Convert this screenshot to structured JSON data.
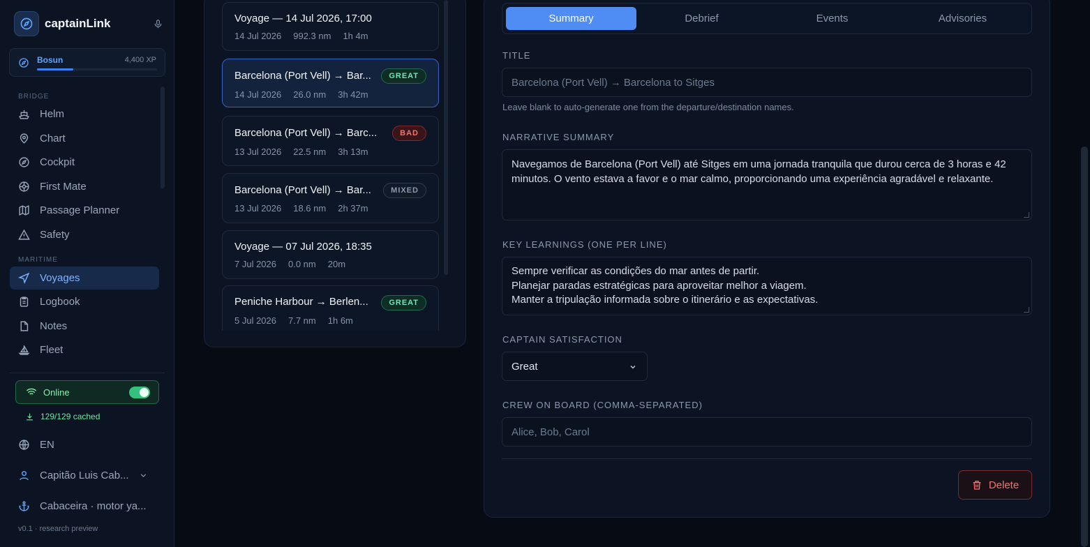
{
  "brand": {
    "name": "captainLink"
  },
  "rank": {
    "name": "Bosun",
    "xp": "4,400 XP",
    "progress": 0.3
  },
  "sidebar": {
    "section_bridge": "BRIDGE",
    "section_maritime": "MARITIME",
    "bridge_items": [
      {
        "label": "Helm",
        "icon": "ship-icon"
      },
      {
        "label": "Chart",
        "icon": "map-pin-icon"
      },
      {
        "label": "Cockpit",
        "icon": "compass-icon"
      },
      {
        "label": "First Mate",
        "icon": "helm-wheel-icon"
      },
      {
        "label": "Passage Planner",
        "icon": "map-icon"
      },
      {
        "label": "Safety",
        "icon": "warning-icon"
      }
    ],
    "maritime_items": [
      {
        "label": "Voyages",
        "icon": "navigation-icon",
        "active": true
      },
      {
        "label": "Logbook",
        "icon": "clipboard-icon"
      },
      {
        "label": "Notes",
        "icon": "file-icon"
      },
      {
        "label": "Fleet",
        "icon": "sailboat-icon"
      }
    ],
    "status": {
      "online_label": "Online",
      "online_on": true,
      "cached": "129/129 cached"
    },
    "language": "EN",
    "user": "Capitão Luis Cab...",
    "vessel": "Cabaceira · motor ya...",
    "version": "v0.1 · research preview"
  },
  "voyages": [
    {
      "title": "Voyage — 14 Jul 2026, 17:00",
      "date": "14 Jul 2026",
      "distance": "992.3 nm",
      "duration": "1h 4m",
      "badge": "",
      "badge_type": ""
    },
    {
      "title": "Barcelona (Port Vell) → Bar...",
      "date": "14 Jul 2026",
      "distance": "26.0 nm",
      "duration": "3h 42m",
      "badge": "GREAT",
      "badge_type": "great",
      "selected": true
    },
    {
      "title": "Barcelona (Port Vell) → Barc...",
      "date": "13 Jul 2026",
      "distance": "22.5 nm",
      "duration": "3h 13m",
      "badge": "BAD",
      "badge_type": "bad"
    },
    {
      "title": "Barcelona (Port Vell) → Bar...",
      "date": "13 Jul 2026",
      "distance": "18.6 nm",
      "duration": "2h 37m",
      "badge": "MIXED",
      "badge_type": "mixed"
    },
    {
      "title": "Voyage — 07 Jul 2026, 18:35",
      "date": "7 Jul 2026",
      "distance": "0.0 nm",
      "duration": "20m",
      "badge": "",
      "badge_type": ""
    },
    {
      "title": "Peniche Harbour → Berlen...",
      "date": "5 Jul 2026",
      "distance": "7.7 nm",
      "duration": "1h 6m",
      "badge": "GREAT",
      "badge_type": "great"
    }
  ],
  "detail": {
    "tabs": [
      "Summary",
      "Debrief",
      "Events",
      "Advisories"
    ],
    "active_tab": 0,
    "title_label": "TITLE",
    "title_placeholder": "Barcelona (Port Vell) → Barcelona to Sitges",
    "title_hint": "Leave blank to auto-generate one from the departure/destination names.",
    "narrative_label": "NARRATIVE SUMMARY",
    "narrative": "Navegamos de Barcelona (Port Vell) até Sitges em uma jornada tranquila que durou cerca de 3 horas e 42 minutos. O vento estava a favor e o mar calmo, proporcionando uma experiência agradável e relaxante.",
    "learnings_label": "KEY LEARNINGS (ONE PER LINE)",
    "learnings": [
      "Sempre verificar as condições do mar antes de partir.",
      "Planejar paradas estratégicas para aproveitar melhor a viagem.",
      "Manter a tripulação informada sobre o itinerário e as expectativas."
    ],
    "satisfaction_label": "CAPTAIN SATISFACTION",
    "satisfaction": "Great",
    "crew_label": "CREW ON BOARD (COMMA-SEPARATED)",
    "crew_placeholder": "Alice, Bob, Carol",
    "delete_label": "Delete"
  },
  "colors": {
    "accent": "#4f8df5",
    "online": "#34c17f",
    "danger": "#f87171"
  }
}
